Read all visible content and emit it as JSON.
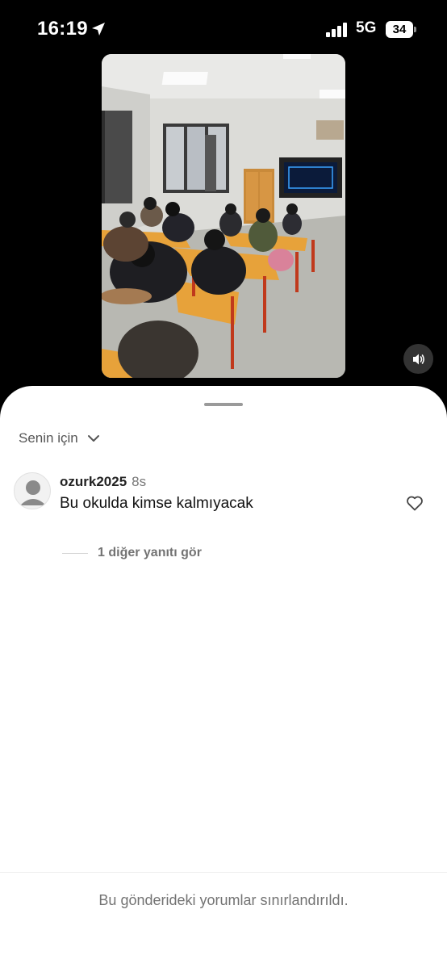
{
  "status_bar": {
    "time": "16:19",
    "network": "5G",
    "battery": "34",
    "icons": [
      "location-arrow-icon",
      "cellular-signal-icon",
      "battery-icon"
    ]
  },
  "video": {
    "description_icon": "classroom-video",
    "volume_icon": "speaker-on-icon"
  },
  "sheet": {
    "filter_label": "Senin için",
    "comments": [
      {
        "username": "ozurk2025",
        "time": "8s",
        "text": "Bu okulda kimse kalmıyacak",
        "replies_label": "1 diğer yanıtı gör"
      }
    ],
    "footer_notice": "Bu gönderideki yorumlar sınırlandırıldı."
  },
  "colors": {
    "background": "#000000",
    "sheet": "#ffffff",
    "secondary_text": "#737373"
  }
}
